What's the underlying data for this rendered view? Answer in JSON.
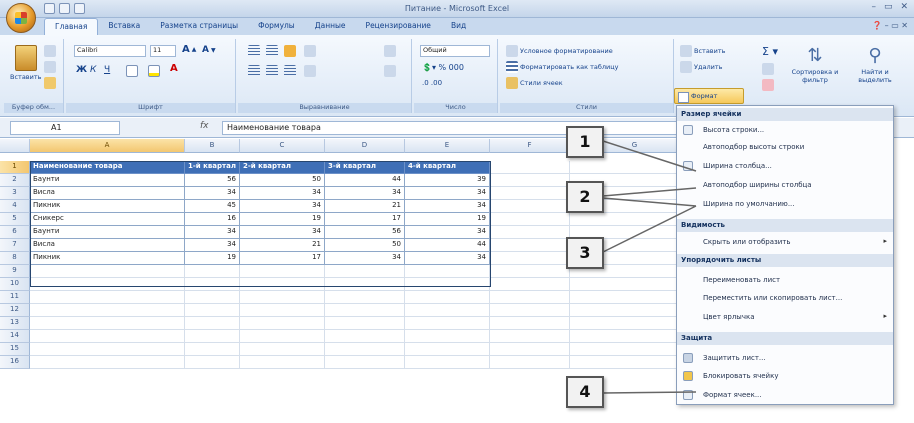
{
  "window": {
    "title": "Питание - Microsoft Excel",
    "controls": [
      "–",
      "▭",
      "✕"
    ]
  },
  "ribbon": {
    "tabs": [
      "Главная",
      "Вставка",
      "Разметка страницы",
      "Формулы",
      "Данные",
      "Рецензирование",
      "Вид"
    ],
    "active_tab": "Главная",
    "clipboard": {
      "paste_label": "Вставить",
      "group_label": "Буфер обм..."
    },
    "font": {
      "name": "Calibri",
      "size": "11",
      "group_label": "Шрифт"
    },
    "alignment": {
      "group_label": "Выравнивание"
    },
    "number": {
      "format": "Общий",
      "group_label": "Число"
    },
    "styles": {
      "conditional": "Условное форматирование",
      "as_table": "Форматировать как таблицу",
      "cell_styles": "Стили ячеек",
      "group_label": "Стили"
    },
    "cells": {
      "insert": "Вставить",
      "delete": "Удалить",
      "format": "Формат"
    },
    "editing": {
      "sort": "Сортировка и фильтр",
      "find": "Найти и выделить"
    }
  },
  "formula_bar": {
    "cell_ref": "A1",
    "fx": "fx",
    "content": "Наименование товара"
  },
  "sheet": {
    "columns": [
      "A",
      "B",
      "C",
      "D",
      "E",
      "F",
      "G"
    ],
    "selected_column": "A",
    "selected_row": "1",
    "header_row": [
      "Наименование товара",
      "1-й квартал",
      "2-й квартал",
      "3-й квартал",
      "4-й квартал"
    ],
    "rows": [
      [
        "Баунти",
        "56",
        "50",
        "44",
        "39"
      ],
      [
        "Висла",
        "34",
        "34",
        "34",
        "34"
      ],
      [
        "Пикник",
        "45",
        "34",
        "21",
        "34"
      ],
      [
        "Сникерс",
        "16",
        "19",
        "17",
        "19"
      ],
      [
        "Баунти",
        "34",
        "34",
        "56",
        "34"
      ],
      [
        "Висла",
        "34",
        "21",
        "50",
        "44"
      ],
      [
        "Пикник",
        "19",
        "17",
        "34",
        "34"
      ]
    ],
    "row_numbers": [
      "1",
      "2",
      "3",
      "4",
      "5",
      "6",
      "7",
      "8",
      "9",
      "10",
      "11",
      "12",
      "13",
      "14",
      "15",
      "16"
    ]
  },
  "menu": {
    "sections": {
      "size": "Размер ячейки",
      "visibility": "Видимость",
      "arrange": "Упорядочить листы",
      "protect": "Защита"
    },
    "items": {
      "row_height": "Высота строки...",
      "autofit_row": "Автоподбор высоты строки",
      "col_width": "Ширина столбца...",
      "autofit_col": "Автоподбор ширины столбца",
      "default_width": "Ширина по умолчанию...",
      "hide_show": "Скрыть или отобразить",
      "rename": "Переименовать лист",
      "move_copy": "Переместить или скопировать лист...",
      "tab_color": "Цвет ярлычка",
      "protect_sheet": "Защитить лист...",
      "lock_cell": "Блокировать ячейку",
      "format_cells": "Формат ячеек..."
    }
  },
  "callouts": [
    "1",
    "2",
    "3",
    "4"
  ],
  "colors": {
    "table_header": "#3f6fb6",
    "ribbon": "#dbe7f5",
    "selected": "#f6c85a"
  }
}
